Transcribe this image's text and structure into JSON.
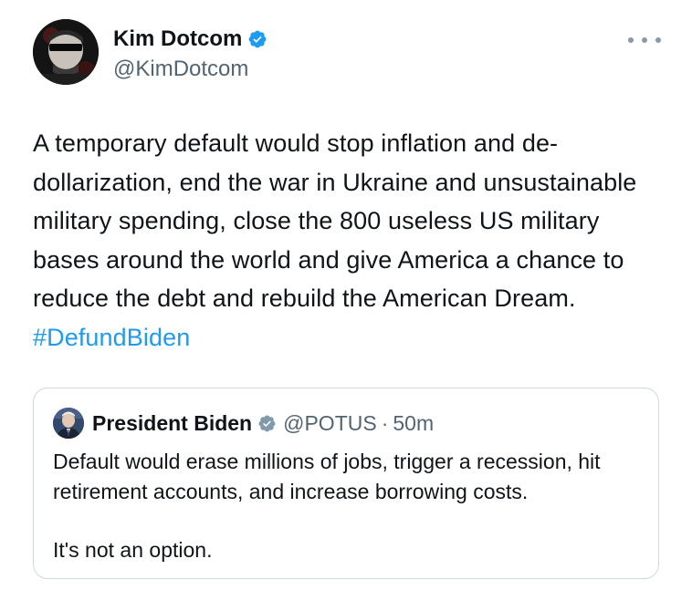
{
  "tweet": {
    "author": {
      "display_name": "Kim Dotcom",
      "handle": "@KimDotcom",
      "verified_icon": "blue-check-icon",
      "avatar_icon": "profile-avatar"
    },
    "more_icon": "more-options-icon",
    "body": "A temporary default would stop inflation and de-dollarization, end the war in Ukraine and unsustainable military spending, close the 800 useless US military bases around the world and give America a chance to reduce the debt and rebuild the American Dream. ",
    "hashtag": "#DefundBiden"
  },
  "quote": {
    "author": {
      "display_name": "President Biden",
      "handle": "@POTUS",
      "separator": "·",
      "time": "50m",
      "verified_icon": "gray-check-icon",
      "avatar_icon": "profile-avatar"
    },
    "paragraphs": [
      "Default would erase millions of jobs, trigger a recession, hit retirement accounts, and increase borrowing costs.",
      "It's not an option."
    ]
  },
  "colors": {
    "text": "#0f1419",
    "secondary": "#536471",
    "link": "#1d9bf0",
    "border": "#cfd9de",
    "verified_blue": "#1d9bf0",
    "verified_gray": "#829aab"
  }
}
